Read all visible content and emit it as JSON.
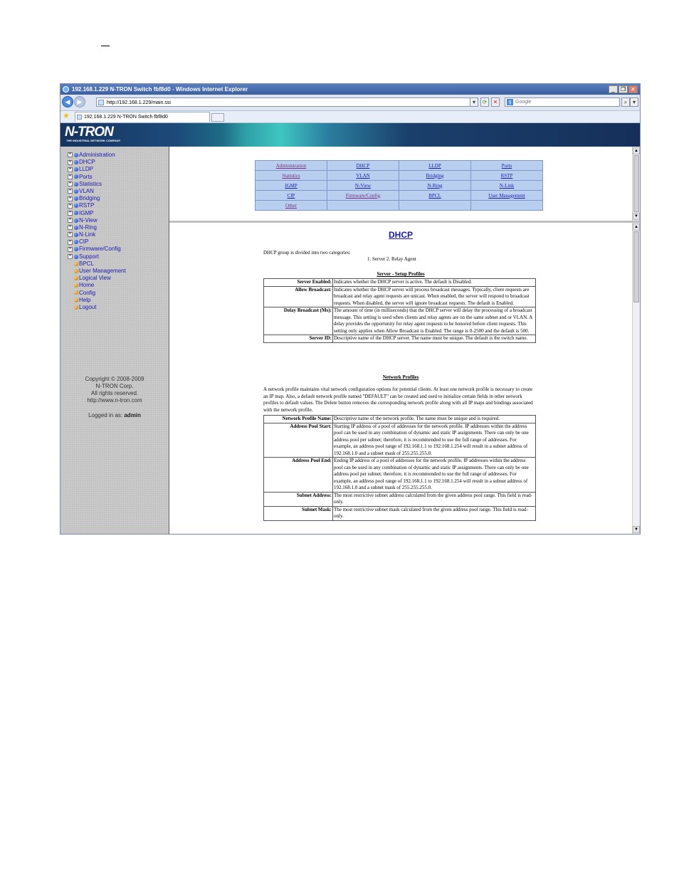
{
  "window": {
    "title": "192.168.1.229 N-TRON Switch fbf8d0 - Windows Internet Explorer",
    "url": "http://192.168.1.229/main.ssi",
    "search_placeholder": "Google",
    "tab_label": "192.168.1.229 N-TRON Switch fbf8d0",
    "controls": [
      "_",
      "❐",
      "✕"
    ]
  },
  "brand": {
    "logo": "N-TRON",
    "tagline": "THE INDUSTRIAL NETWORK COMPANY"
  },
  "sidebar": {
    "items": [
      {
        "label": "Administration",
        "expandable": true,
        "color": "blue"
      },
      {
        "label": "DHCP",
        "expandable": true,
        "color": "blue"
      },
      {
        "label": "LLDP",
        "expandable": true,
        "color": "blue"
      },
      {
        "label": "Ports",
        "expandable": true,
        "color": "blue"
      },
      {
        "label": "Statistics",
        "expandable": true,
        "color": "blue"
      },
      {
        "label": "VLAN",
        "expandable": true,
        "color": "blue"
      },
      {
        "label": "Bridging",
        "expandable": true,
        "color": "blue"
      },
      {
        "label": "RSTP",
        "expandable": true,
        "color": "blue"
      },
      {
        "label": "IGMP",
        "expandable": true,
        "color": "blue"
      },
      {
        "label": "N-View",
        "expandable": true,
        "color": "blue"
      },
      {
        "label": "N-Ring",
        "expandable": true,
        "color": "blue"
      },
      {
        "label": "N-Link",
        "expandable": true,
        "color": "blue"
      },
      {
        "label": "CIP",
        "expandable": true,
        "color": "blue"
      },
      {
        "label": "Firmware/Config",
        "expandable": true,
        "color": "blue"
      },
      {
        "label": "Support",
        "expandable": true,
        "color": "blue"
      },
      {
        "label": "BPCL",
        "expandable": false,
        "color": "orange"
      },
      {
        "label": "User Management",
        "expandable": false,
        "color": "orange"
      },
      {
        "label": "Logical View",
        "expandable": false,
        "color": "orange"
      },
      {
        "label": "Home",
        "expandable": false,
        "color": "orange"
      },
      {
        "label": "Config",
        "expandable": false,
        "color": "orange"
      },
      {
        "label": "Help",
        "expandable": false,
        "color": "orange"
      },
      {
        "label": "Logout",
        "expandable": false,
        "color": "orange"
      }
    ],
    "copyright_lines": [
      "Copyright © 2008-2009",
      "N-TRON Corp.",
      "All rights reserved.",
      "http://www.n-tron.com"
    ],
    "logged_in_prefix": "Logged in as:",
    "logged_in_user": "admin"
  },
  "menu_table": {
    "rows": [
      [
        "Administration",
        "DHCP",
        "LLDP",
        "Ports"
      ],
      [
        "Statistics",
        "VLAN",
        "Bridging",
        "RSTP"
      ],
      [
        "IGMP",
        "N-View",
        "N-Ring",
        "N-Link"
      ],
      [
        "CIP",
        "Firmware/Config",
        "BPCL",
        "User Management"
      ],
      [
        "Other",
        "",
        "",
        ""
      ]
    ],
    "visited": [
      "Administration",
      "Statistics",
      "Firmware/Config",
      "Other"
    ]
  },
  "main": {
    "title": "DHCP",
    "intro": "DHCP group is divided into two categories:",
    "categories": "1. Server   2. Relay Agent",
    "server_heading": "Server - Setup Profiles",
    "server_rows": [
      {
        "label": "Server Enabled:",
        "text": "Indicates whether the DHCP server is active. The default is Disabled."
      },
      {
        "label": "Allow Broadcast:",
        "text": "Indicates whether the DHCP server will process broadcast messages. Typically, client requests are broadcast and relay agent requests are unicast. When enabled, the server will respond to broadcast requests. When disabled, the server will ignore broadcast requests. The default is Enabled."
      },
      {
        "label": "Delay Broadcast (Ms):",
        "text": "The amount of time (in milliseconds) that the DHCP server will delay the processing of a broadcast message. This setting is used when clients and relay agents are on the same subnet and or VLAN. A delay provides the opportunity for relay agent requests to be honored before client requests. This setting only applies when Allow Broadcast is Enabled. The range is 0-2500 and the default is 500."
      },
      {
        "label": "Server ID:",
        "text": "Descriptive name of the DHCP server. The name must be unique. The default is the switch name."
      }
    ],
    "network_heading": "Network Profiles",
    "network_intro": "A network profile maintains vital network configuration options for potential clients. At least one network profile is necessary to create an IP map. Also, a default network profile named \"DEFAULT\" can be created and used to initialize certain fields in other network profiles to default values. The Delete button removes the corresponding network profile along with all IP maps and bindings associated with the network profile.",
    "network_rows": [
      {
        "label": "Network Profile Name:",
        "text": "Descriptive name of the network profile. The name must be unique and is required."
      },
      {
        "label": "Address Pool Start:",
        "text": "Starting IP address of a pool of addresses for the network profile. IP addresses within the address pool can be used in any combination of dynamic and static IP assignments. There can only be one address pool per subnet; therefore, it is recommended to use the full range of addresses. For example, an address pool range of 192.168.1.1 to 192.168.1.254 will result in a subnet address of 192.168.1.0 and a subnet mask of 255.255.255.0."
      },
      {
        "label": "Address Pool End:",
        "text": "Ending IP address of a pool of addresses for the network profile. IP addresses within the address pool can be used in any combination of dynamic and static IP assignments. There can only be one address pool per subnet; therefore, it is recommended to use the full range of addresses. For example, an address pool range of 192.168.1.1 to 192.168.1.254 will result in a subnet address of 192.168.1.0 and a subnet mask of 255.255.255.0."
      },
      {
        "label": "Subnet Address:",
        "text": "The most restrictive subnet address calculated from the given address pool range. This field is read-only."
      },
      {
        "label": "Subnet Mask:",
        "text": "The most restrictive subnet mask calculated from the given address pool range. This field is read-only."
      }
    ]
  }
}
